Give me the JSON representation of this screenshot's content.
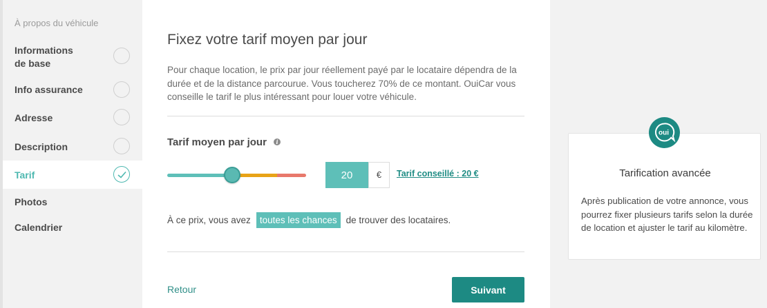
{
  "sidebar": {
    "heading": "À propos du véhicule",
    "items": [
      {
        "label": "Informations\nde base",
        "active": false
      },
      {
        "label": "Info assurance",
        "active": false
      },
      {
        "label": "Adresse",
        "active": false
      },
      {
        "label": "Description",
        "active": false
      },
      {
        "label": "Tarif",
        "active": true
      },
      {
        "label": "Photos",
        "active": false
      },
      {
        "label": "Calendrier",
        "active": false
      }
    ]
  },
  "main": {
    "title": "Fixez votre tarif moyen par jour",
    "description": "Pour chaque location, le prix par jour réellement payé par le locataire dépendra de la durée et de la distance parcourue. Vous toucherez 70% de ce montant. OuiCar vous conseille le tarif le plus intéressant pour louer votre véhicule.",
    "tarif_label": "Tarif moyen par jour",
    "info_icon": "info-icon",
    "price_value": "20",
    "currency": "€",
    "recommended_link": "Tarif conseillé : 20 €",
    "slider_level": 0.47,
    "chance_prefix": "À ce prix, vous avez",
    "chance_badge": "toutes les chances",
    "chance_suffix": "de trouver des locataires.",
    "back_label": "Retour",
    "next_label": "Suivant"
  },
  "info_card": {
    "logo_text": "oui",
    "title": "Tarification avancée",
    "text": "Après publication de votre annonce, vous pourrez fixer plusieurs tarifs selon la durée de location et ajuster le tarif au kilomètre."
  },
  "colors": {
    "teal": "#5ebfb8",
    "dark_teal": "#1d8a83",
    "slider_orange": "#e8a317",
    "slider_red": "#e8786b"
  }
}
